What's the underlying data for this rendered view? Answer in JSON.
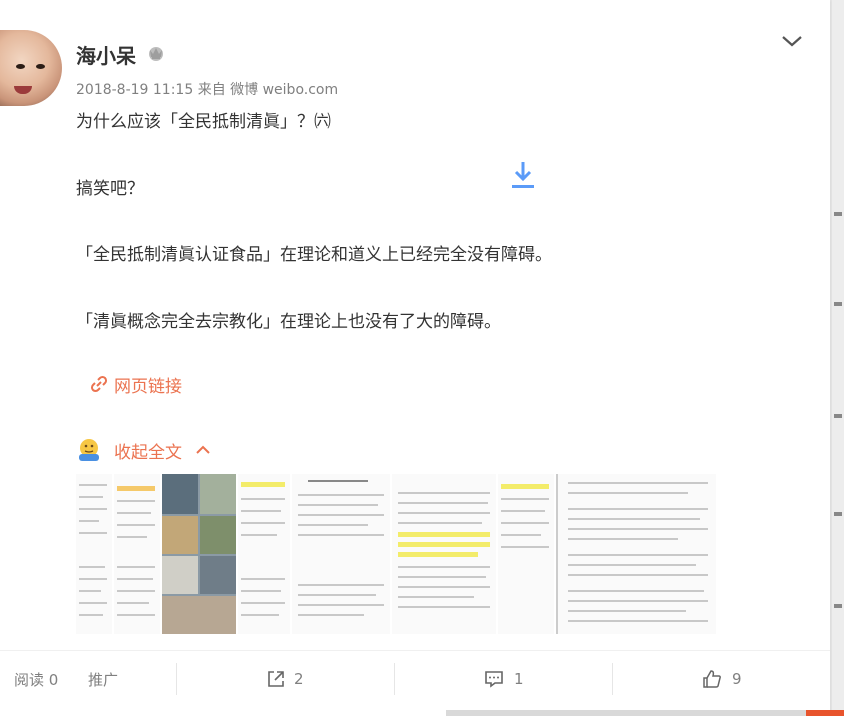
{
  "post": {
    "username": "海小呆",
    "meta": "2018-8-19 11:15  来自 微博 weibo.com",
    "lines": [
      "为什么应该「全民抵制清眞」？㈥",
      "搞笑吧？",
      "「全民抵制清眞认证食品」在理论和道义上已经完全没有障碍。",
      "「清眞概念完全去宗教化」在理论上也没有了大的障碍。"
    ],
    "link_label": "网页链接",
    "collapse_label": "收起全文"
  },
  "actions": {
    "read_label": "阅读 0",
    "promote_label": "推广",
    "share_count": "2",
    "comment_count": "1",
    "like_count": "9"
  },
  "colors": {
    "accent": "#eb7350",
    "text": "#333333",
    "meta": "#808080"
  },
  "icons": [
    "vip-crown-icon",
    "chevron-down-icon",
    "download-icon",
    "link-icon",
    "emoji-icon",
    "chevron-up-icon",
    "share-icon",
    "comment-icon",
    "like-icon"
  ]
}
